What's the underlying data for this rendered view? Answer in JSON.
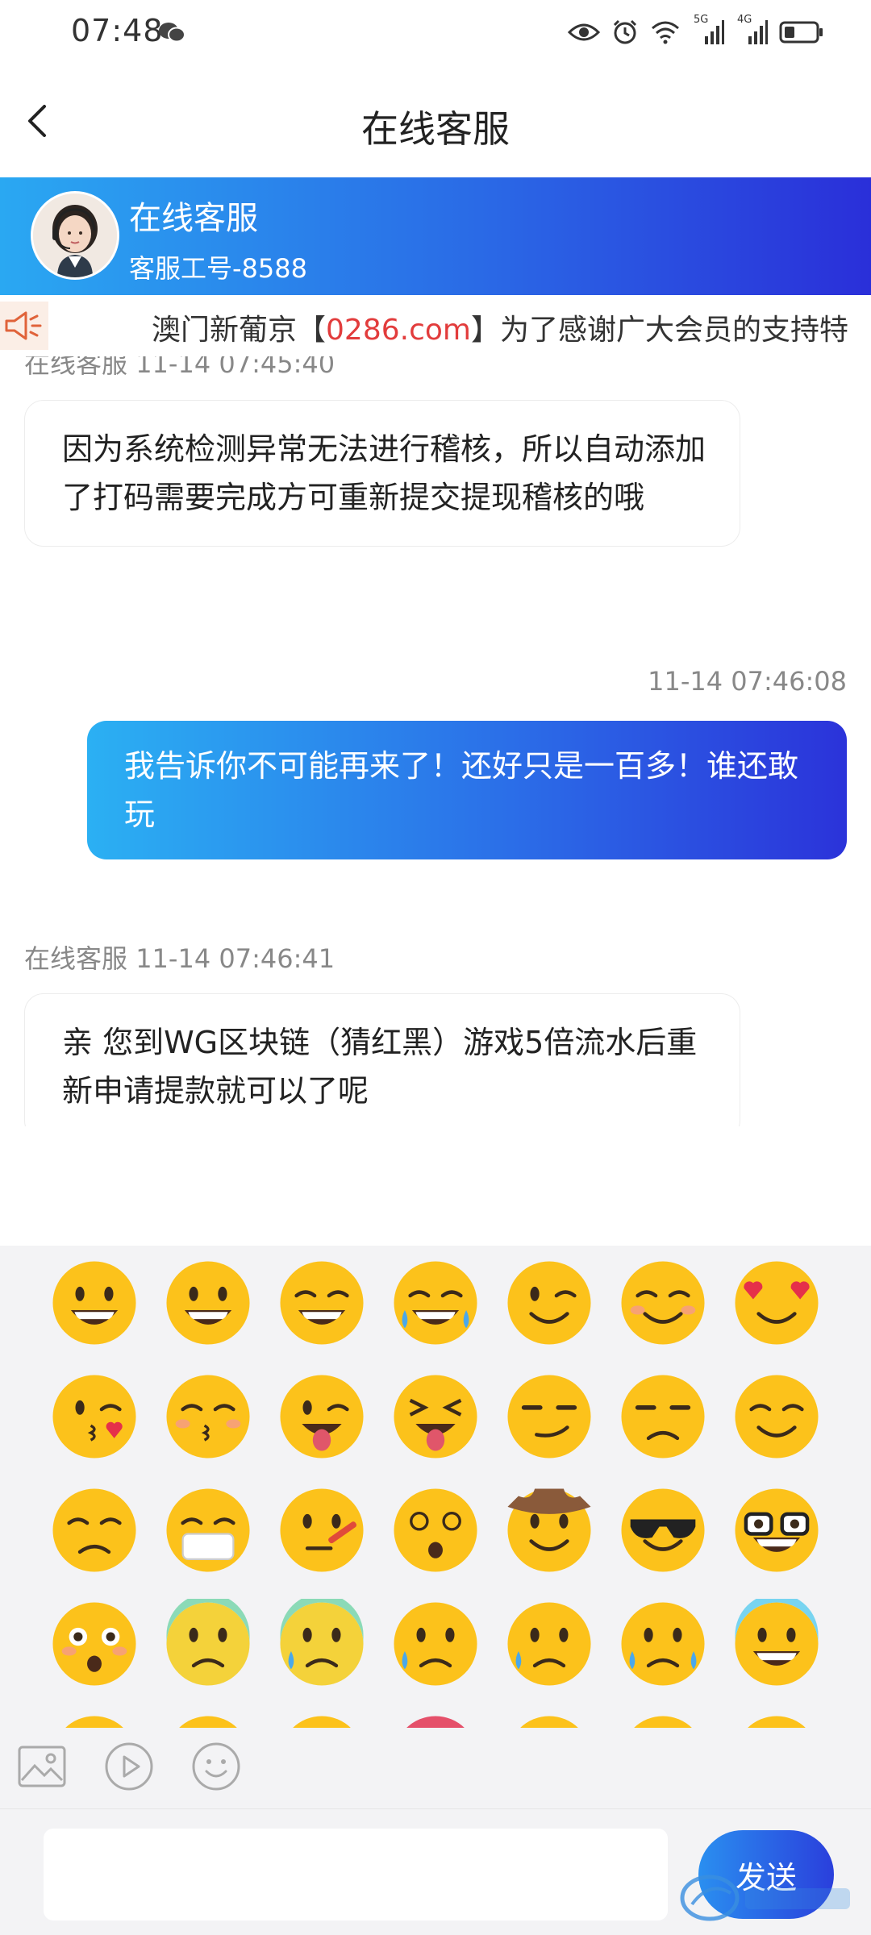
{
  "status_bar": {
    "time": "07:48",
    "network_1": "5G",
    "network_2": "4G"
  },
  "nav": {
    "title": "在线客服"
  },
  "agent": {
    "name": "在线客服",
    "id_label": "客服工号-8588"
  },
  "notice": {
    "prefix": "澳门新葡京【",
    "link": "0286.com",
    "suffix": "】为了感谢广大会员的支持特"
  },
  "messages": [
    {
      "sender": "在线客服",
      "time": "11-14 07:45:40",
      "direction": "in",
      "text": "因为系统检测异常无法进行稽核，所以自动添加了打码需要完成方可重新提交提现稽核的哦"
    },
    {
      "sender": "",
      "time": "11-14 07:46:08",
      "direction": "out",
      "text": "我告诉你不可能再来了！还好只是一百多！谁还敢玩"
    },
    {
      "sender": "在线客服",
      "time": "11-14 07:46:41",
      "direction": "in",
      "text": "亲  您到WG区块链（猜红黑）游戏5倍流水后重新申请提款就可以了呢"
    }
  ],
  "emoji_names": [
    "grinning-face",
    "grinning-smiling-eyes",
    "beaming-face",
    "tears-of-joy",
    "winking-face",
    "smiling-blush",
    "heart-eyes",
    "face-blowing-kiss",
    "kissing-smiling-eyes",
    "winking-tongue",
    "squinting-tongue",
    "smirking-face",
    "unamused-face",
    "relieved-face",
    "pensive-face",
    "medical-mask",
    "face-with-thermometer",
    "dizzy-face",
    "cowboy-face",
    "sunglasses-face",
    "nerd-face",
    "flushed-face",
    "hushed-face",
    "anxious-sweat",
    "worried-face",
    "crying-face",
    "loudly-crying",
    "screaming-fear"
  ],
  "toolbar": {
    "image_icon": "image-icon",
    "video_icon": "video-icon",
    "emoji_icon": "emoji-icon"
  },
  "composer": {
    "placeholder": "",
    "send_label": "发送"
  },
  "colors": {
    "accent_start": "#2aa8f2",
    "accent_end": "#2a2fd9",
    "link_red": "#e23c3c"
  }
}
